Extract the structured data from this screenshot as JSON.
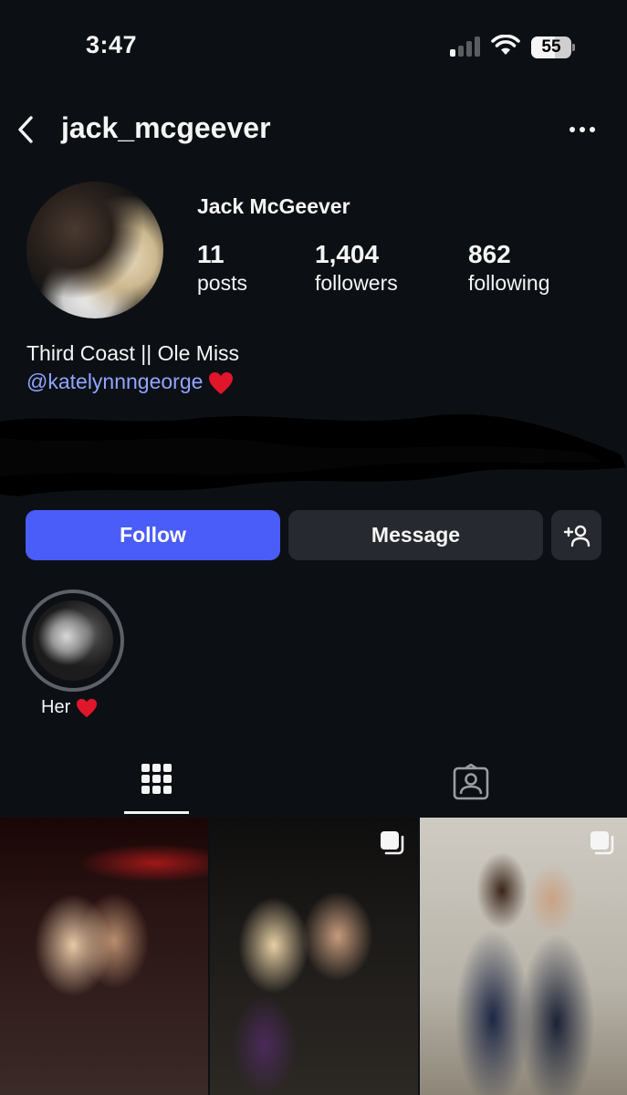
{
  "status_bar": {
    "time": "3:47",
    "battery": "55"
  },
  "header": {
    "username": "jack_mcgeever"
  },
  "profile": {
    "display_name": "Jack McGeever",
    "stats": [
      {
        "value": "11",
        "label": "posts"
      },
      {
        "value": "1,404",
        "label": "followers"
      },
      {
        "value": "862",
        "label": "following"
      }
    ],
    "bio_line1": "Third Coast || Ole Miss",
    "bio_mention": "@katelynnngeorge"
  },
  "actions": {
    "follow_label": "Follow",
    "message_label": "Message"
  },
  "highlights": [
    {
      "label": "Her"
    }
  ],
  "colors": {
    "background": "#0c1014",
    "follow_blue": "#4a5df9",
    "mention_blue": "#8fa5ff",
    "secondary_button": "#26292f"
  },
  "icons": [
    "back-icon",
    "more-icon",
    "heart-icon",
    "add-user-icon",
    "grid-icon",
    "tagged-icon",
    "multi-photo-icon"
  ]
}
